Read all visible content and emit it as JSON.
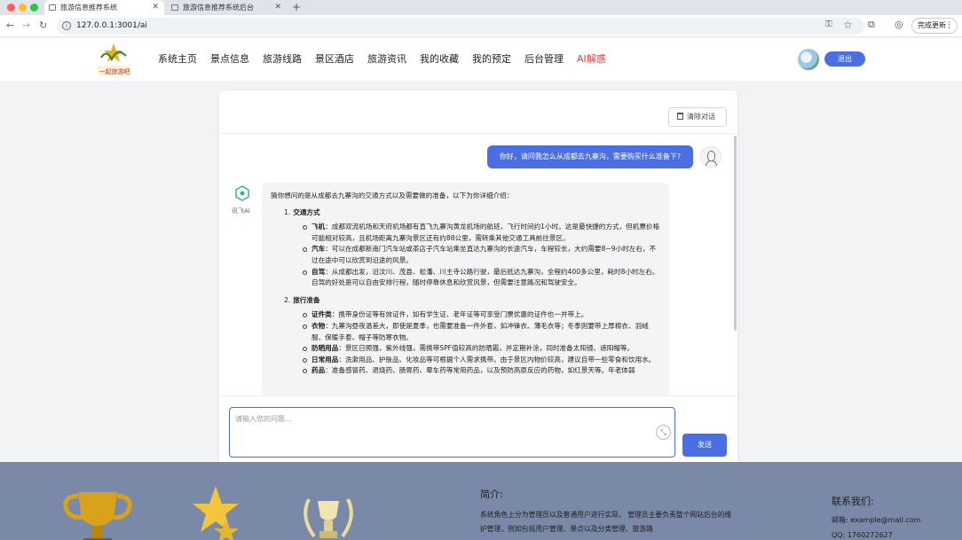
{
  "browser": {
    "tabs": [
      {
        "title": "旅游信息推荐系统",
        "active": true
      },
      {
        "title": "旅游信息推荐系统后台",
        "active": false
      }
    ],
    "new_tab": "+",
    "url": "127.0.0.1:3001/ai",
    "update_button": "完成更新",
    "traffic_colors": [
      "#ff5f57",
      "#febc2e",
      "#28c840"
    ]
  },
  "header": {
    "logo_text": "一起旅游吧",
    "nav": [
      {
        "label": "系统主页",
        "active": false
      },
      {
        "label": "景点信息",
        "active": false
      },
      {
        "label": "旅游线路",
        "active": false
      },
      {
        "label": "景区酒店",
        "active": false
      },
      {
        "label": "旅游资讯",
        "active": false
      },
      {
        "label": "我的收藏",
        "active": false
      },
      {
        "label": "我的预定",
        "active": false
      },
      {
        "label": "后台管理",
        "active": false
      },
      {
        "label": "AI解惑",
        "active": true
      }
    ],
    "logout_label": "退出"
  },
  "chat": {
    "clear_label": "清除对话",
    "user_message": "你好，请问我怎么从成都去九寨沟，需要购买什么准备下?",
    "ai_name": "讯飞AI",
    "ai_intro": "猜你想问的是从成都去九寨沟的交通方式以及需要做的准备，以下为你详细介绍：",
    "sections": [
      {
        "num": "1.",
        "title": "交通方式",
        "items": [
          {
            "label": "飞机",
            "text": "：成都双流机场和天府机场都有直飞九寨沟黄龙机场的航班，飞行时间约1小时。这是最快捷的方式，但机票价格可能相对较高，且机场距离九寨沟景区还有约88公里，需转乘其他交通工具前往景区。"
          },
          {
            "label": "汽车",
            "text": "：可以在成都新南门汽车站或茶店子汽车站乘坐直达九寨沟的长途汽车，车程较长，大约需要8~9小时左右，不过在途中可以欣赏到沿途的风景。"
          },
          {
            "label": "自驾",
            "text": "：从成都出发，沿汶川、茂县、松潘、川主寺公路行驶，最后抵达九寨沟，全程约400多公里，耗时8小时左右。自驾的好处是可以自由安排行程，随时停靠休息和欣赏风景，但需要注意路况和驾驶安全。"
          }
        ]
      },
      {
        "num": "2.",
        "title": "旅行准备",
        "items": [
          {
            "label": "证件类",
            "text": "：携带身份证等有效证件，如有学生证、老年证等可享受门票优惠的证件也一并带上。"
          },
          {
            "label": "衣物",
            "text": "：九寨沟昼夜温差大，即使是夏季，也需要准备一件外套，如冲锋衣、薄毛衣等；冬季则要带上厚棉衣、羽绒服、保暖手套、帽子等防寒衣物。"
          },
          {
            "label": "防晒用品",
            "text": "：景区日照强，紫外线强，需携带SPF值较高的防晒霜，并定期补涂，同时准备太阳镜、遮阳帽等。"
          },
          {
            "label": "日常用品",
            "text": "：洗漱用品、护肤品、化妆品等可根据个人需求携带。由于景区内物价较高，建议自带一些零食和饮用水。"
          },
          {
            "label": "药品",
            "text": "：准备感冒药、退烧药、肠胃药、晕车药等常用药品，以及预防高原反应的药物，如红景天等。年老体弱"
          }
        ]
      }
    ],
    "input_placeholder": "请输入您的问题...",
    "send_label": "发送"
  },
  "footer": {
    "about_title": "简介:",
    "about_text": "系统角色上分为管理员以及普通用户进行实现。 管理员主要负责整个网站后台的维护管理，例如包括用户管理、景点以及分类管理、旅游路",
    "contact_title": "联系我们:",
    "email": "邮箱: example@mail.com",
    "qq": "QQ: 1760272627"
  },
  "colors": {
    "accent": "#4b6fe0",
    "active_nav": "#e23c3c",
    "footer_bg": "#7a89a7"
  }
}
